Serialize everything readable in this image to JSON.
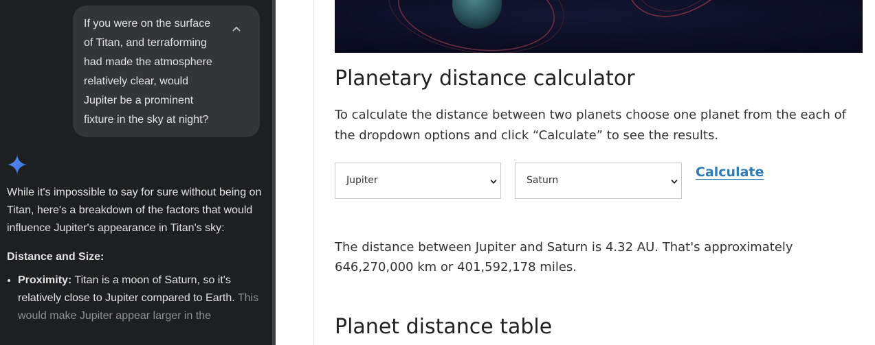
{
  "chat": {
    "user_prompt": "If you were on the surface of Titan, and terraforming had made the atmosphere relatively clear, would Jupiter be a prominent fixture in the sky at night?",
    "response": {
      "intro": "While it's impossible to say for sure without being on Titan, here's a breakdown of the factors that would influence Jupiter's appearance in Titan's sky:",
      "section_heading": "Distance and Size:",
      "bullets": [
        {
          "label": "Proximity:",
          "text": " Titan is a moon of Saturn, so it's relatively close to Jupiter compared to Earth.",
          "faded_text": " This would make Jupiter appear larger in the"
        }
      ]
    }
  },
  "page": {
    "calculator_title": "Planetary distance calculator",
    "calculator_description": "To calculate the distance between two planets choose one planet from the each of the dropdown options and click “Calculate” to see the results.",
    "select_planet_1": "Jupiter",
    "select_planet_2": "Saturn",
    "calculate_label": "Calculate",
    "result_text": "The distance between Jupiter and Saturn is 4.32 AU. That's approximately 646,270,000 km or 401,592,178 miles.",
    "table_title": "Planet distance table"
  },
  "colors": {
    "chat_background": "#1e1f20",
    "user_bubble": "#333537",
    "gemini_accent": "#4285f4",
    "link_blue": "#2d7bb5",
    "hero_background": "#0b0c22"
  },
  "icons": {
    "collapse": "chevron-up-icon",
    "assistant": "gemini-sparkle-icon",
    "select_arrow": "chevron-down-icon"
  }
}
